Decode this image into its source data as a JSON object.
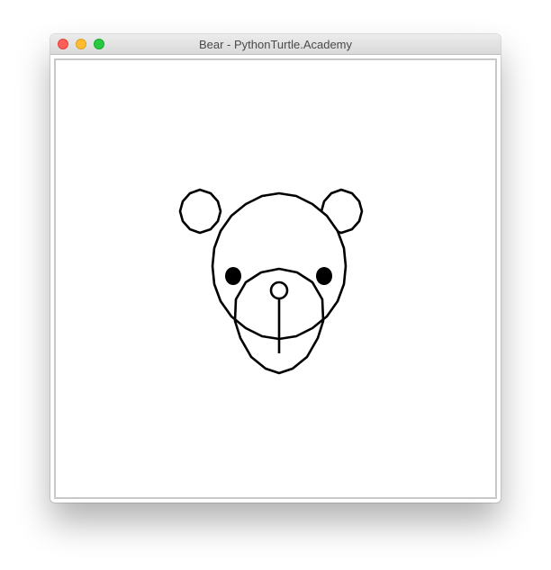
{
  "window": {
    "title": "Bear - PythonTurtle.Academy"
  },
  "colors": {
    "close_button": "#fe5f57",
    "minimize_button": "#febc2e",
    "maximize_button": "#28c840",
    "stroke": "#000000",
    "canvas_background": "#ffffff"
  },
  "icons": [
    "close-icon",
    "minimize-icon",
    "maximize-icon"
  ]
}
